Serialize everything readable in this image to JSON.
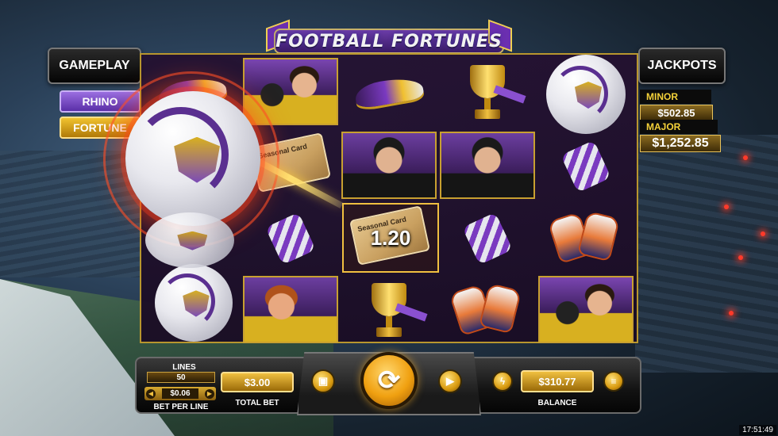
{
  "game": {
    "title": "FOOTBALL FORTUNES"
  },
  "gameplay": {
    "heading": "GAMEPLAY",
    "modes": [
      {
        "label": "RHINO",
        "color": "#7a4ad0"
      },
      {
        "label": "FORTUNE",
        "color": "#e0a818",
        "selected": true
      }
    ]
  },
  "jackpots": {
    "heading": "JACKPOTS",
    "minor": {
      "label": "MINOR",
      "value": "$502.85"
    },
    "major": {
      "label": "MAJOR",
      "value": "$1,252.85"
    }
  },
  "reels": {
    "win_amount": "1.20",
    "ticket_text": "Seasonal Card",
    "grid": [
      [
        "boot",
        "keeper",
        "boot",
        "trophy",
        "ball"
      ],
      [
        "ball",
        "ticket",
        "referee",
        "referee",
        "scarf"
      ],
      [
        "ball",
        "scarf",
        "ticket",
        "scarf",
        "gloves"
      ],
      [
        "ball",
        "ginger",
        "trophy",
        "gloves",
        "keeper"
      ]
    ]
  },
  "controls": {
    "lines_label": "LINES",
    "lines_value": "50",
    "bet_per_line_value": "$0.06",
    "bet_per_line_label": "BET PER LINE",
    "total_bet_value": "$3.00",
    "total_bet_label": "TOTAL BET",
    "balance_value": "$310.77",
    "balance_label": "BALANCE",
    "spin_icon": "spin-arrows-icon",
    "buy_icon": "gift-icon",
    "autoplay_icon": "autoplay-icon",
    "turbo_icon": "lightning-icon",
    "menu_icon": "menu-icon"
  },
  "clock": "17:51:49"
}
